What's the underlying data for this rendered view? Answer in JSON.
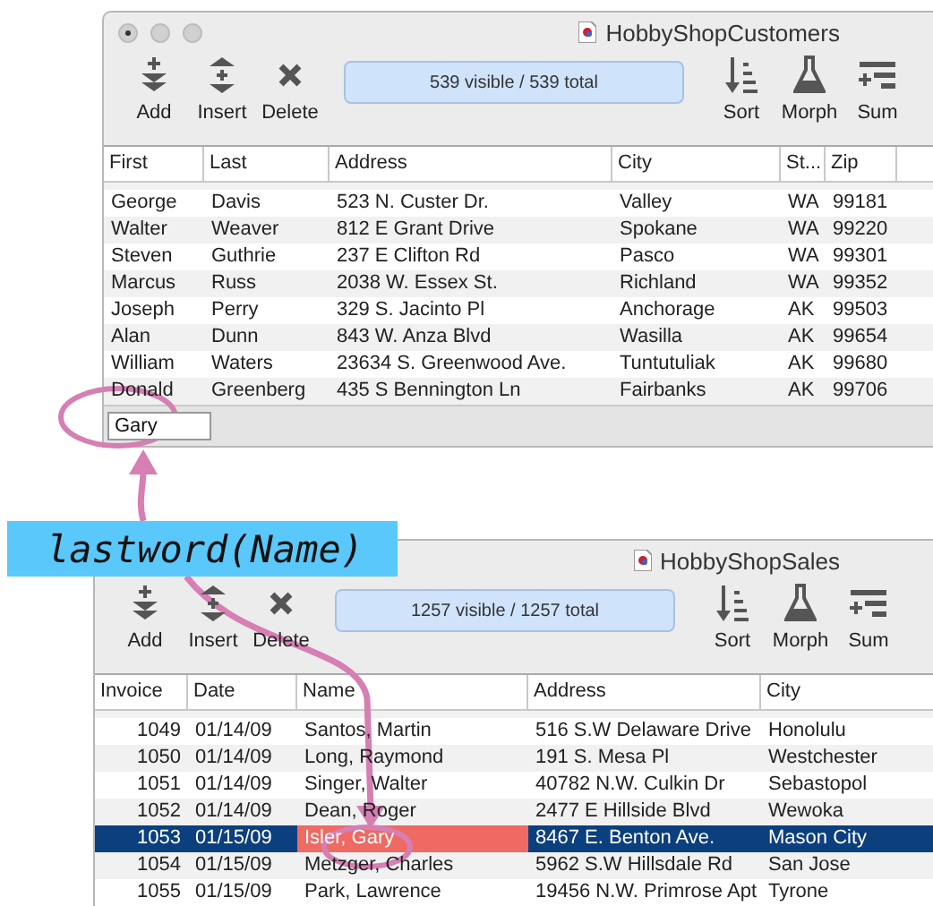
{
  "windows": [
    {
      "title": "HobbyShopCustomers",
      "status": "539 visible / 539 total",
      "toolbar_left": [
        {
          "label": "Add",
          "kind": "add"
        },
        {
          "label": "Insert",
          "kind": "insert"
        },
        {
          "label": "Delete",
          "kind": "delete"
        }
      ],
      "toolbar_right": [
        {
          "label": "Sort",
          "kind": "sort"
        },
        {
          "label": "Morph",
          "kind": "morph"
        },
        {
          "label": "Sum",
          "kind": "sum"
        }
      ],
      "columns": [
        {
          "label": "First"
        },
        {
          "label": "Last"
        },
        {
          "label": "Address"
        },
        {
          "label": "City"
        },
        {
          "label": "St..."
        },
        {
          "label": "Zip"
        }
      ],
      "rows": [
        {
          "cells": [
            "George",
            "Davis",
            "523 N. Custer Dr.",
            "Valley",
            "WA",
            "99181"
          ],
          "selected": false
        },
        {
          "cells": [
            "Walter",
            "Weaver",
            "812 E Grant Drive",
            "Spokane",
            "WA",
            "99220"
          ],
          "selected": false
        },
        {
          "cells": [
            "Steven",
            "Guthrie",
            "237 E Clifton Rd",
            "Pasco",
            "WA",
            "99301"
          ],
          "selected": false
        },
        {
          "cells": [
            "Marcus",
            "Russ",
            "2038 W. Essex St.",
            "Richland",
            "WA",
            "99352"
          ],
          "selected": false
        },
        {
          "cells": [
            "Joseph",
            "Perry",
            "329 S. Jacinto Pl",
            "Anchorage",
            "AK",
            "99503"
          ],
          "selected": false
        },
        {
          "cells": [
            "Alan",
            "Dunn",
            "843 W. Anza Blvd",
            "Wasilla",
            "AK",
            "99654"
          ],
          "selected": false
        },
        {
          "cells": [
            "William",
            "Waters",
            "23634 S. Greenwood Ave.",
            "Tuntutuliak",
            "AK",
            "99680"
          ],
          "selected": false
        },
        {
          "cells": [
            "Donald",
            "Greenberg",
            "435 S Bennington Ln",
            "Fairbanks",
            "AK",
            "99706"
          ],
          "selected": false
        }
      ],
      "editor": {
        "value": "Gary"
      }
    },
    {
      "title": "HobbyShopSales",
      "status": "1257 visible / 1257 total",
      "toolbar_left": [
        {
          "label": "Add",
          "kind": "add"
        },
        {
          "label": "Insert",
          "kind": "insert"
        },
        {
          "label": "Delete",
          "kind": "delete"
        }
      ],
      "toolbar_right": [
        {
          "label": "Sort",
          "kind": "sort"
        },
        {
          "label": "Morph",
          "kind": "morph"
        },
        {
          "label": "Sum",
          "kind": "sum"
        }
      ],
      "columns": [
        {
          "label": "Invoice",
          "active": false
        },
        {
          "label": "Date",
          "active": false
        },
        {
          "label": "Name",
          "active": true
        },
        {
          "label": "Address",
          "active": false
        },
        {
          "label": "City",
          "active": false
        }
      ],
      "rows": [
        {
          "cells": [
            "1049",
            "01/14/09",
            "Santos, Martin",
            "516 S.W Delaware Drive",
            "Honolulu"
          ],
          "selected": false
        },
        {
          "cells": [
            "1050",
            "01/14/09",
            "Long, Raymond",
            "191 S. Mesa Pl",
            "Westchester"
          ],
          "selected": false
        },
        {
          "cells": [
            "1051",
            "01/14/09",
            "Singer, Walter",
            "40782 N.W. Culkin Dr",
            "Sebastopol"
          ],
          "selected": false
        },
        {
          "cells": [
            "1052",
            "01/14/09",
            "Dean, Roger",
            "2477 E Hillside Blvd",
            "Wewoka"
          ],
          "selected": false
        },
        {
          "cells": [
            "1053",
            "01/15/09",
            "Isler, Gary",
            "8467 E. Benton Ave.",
            "Mason City"
          ],
          "selected": true
        },
        {
          "cells": [
            "1054",
            "01/15/09",
            "Metzger, Charles",
            "5962 S.W Hillsdale Rd",
            "San Jose"
          ],
          "selected": false
        },
        {
          "cells": [
            "1055",
            "01/15/09",
            "Park, Lawrence",
            "19456 N.W. Primrose Apt",
            "Tyrone"
          ],
          "selected": false
        }
      ]
    }
  ],
  "annotation": {
    "label": "lastword(Name)"
  }
}
